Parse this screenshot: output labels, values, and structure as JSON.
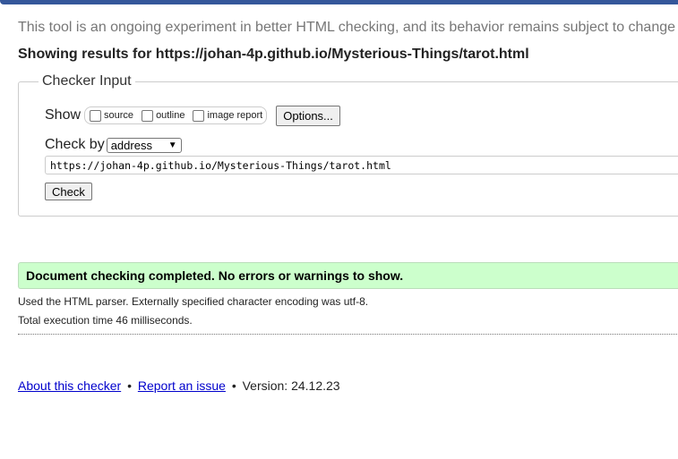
{
  "banner": {
    "text": "This tool is an ongoing experiment in better HTML checking, and its behavior remains subject to change"
  },
  "results": {
    "prefix": "Showing results for ",
    "url": "https://johan-4p.github.io/Mysterious-Things/tarot.html"
  },
  "checker_input": {
    "legend": "Checker Input",
    "show_label": "Show",
    "show_options": [
      {
        "label": "source",
        "checked": false
      },
      {
        "label": "outline",
        "checked": false
      },
      {
        "label": "image report",
        "checked": false
      }
    ],
    "options_button": "Options...",
    "check_by_label": "Check by",
    "check_by_selected": "address",
    "url_value": "https://johan-4p.github.io/Mysterious-Things/tarot.html",
    "check_button": "Check"
  },
  "result_message": "Document checking completed. No errors or warnings to show.",
  "parser_note": "Used the HTML parser. Externally specified character encoding was utf-8.",
  "exec_time": "Total execution time 46 milliseconds.",
  "footer": {
    "about_link": "About this checker",
    "bullet": "•",
    "report_link": "Report an issue",
    "version_text": "Version: 24.12.23"
  },
  "colors": {
    "top_bar": "#35579a",
    "success_bg": "#ccffcc",
    "link": "#0000cc"
  }
}
